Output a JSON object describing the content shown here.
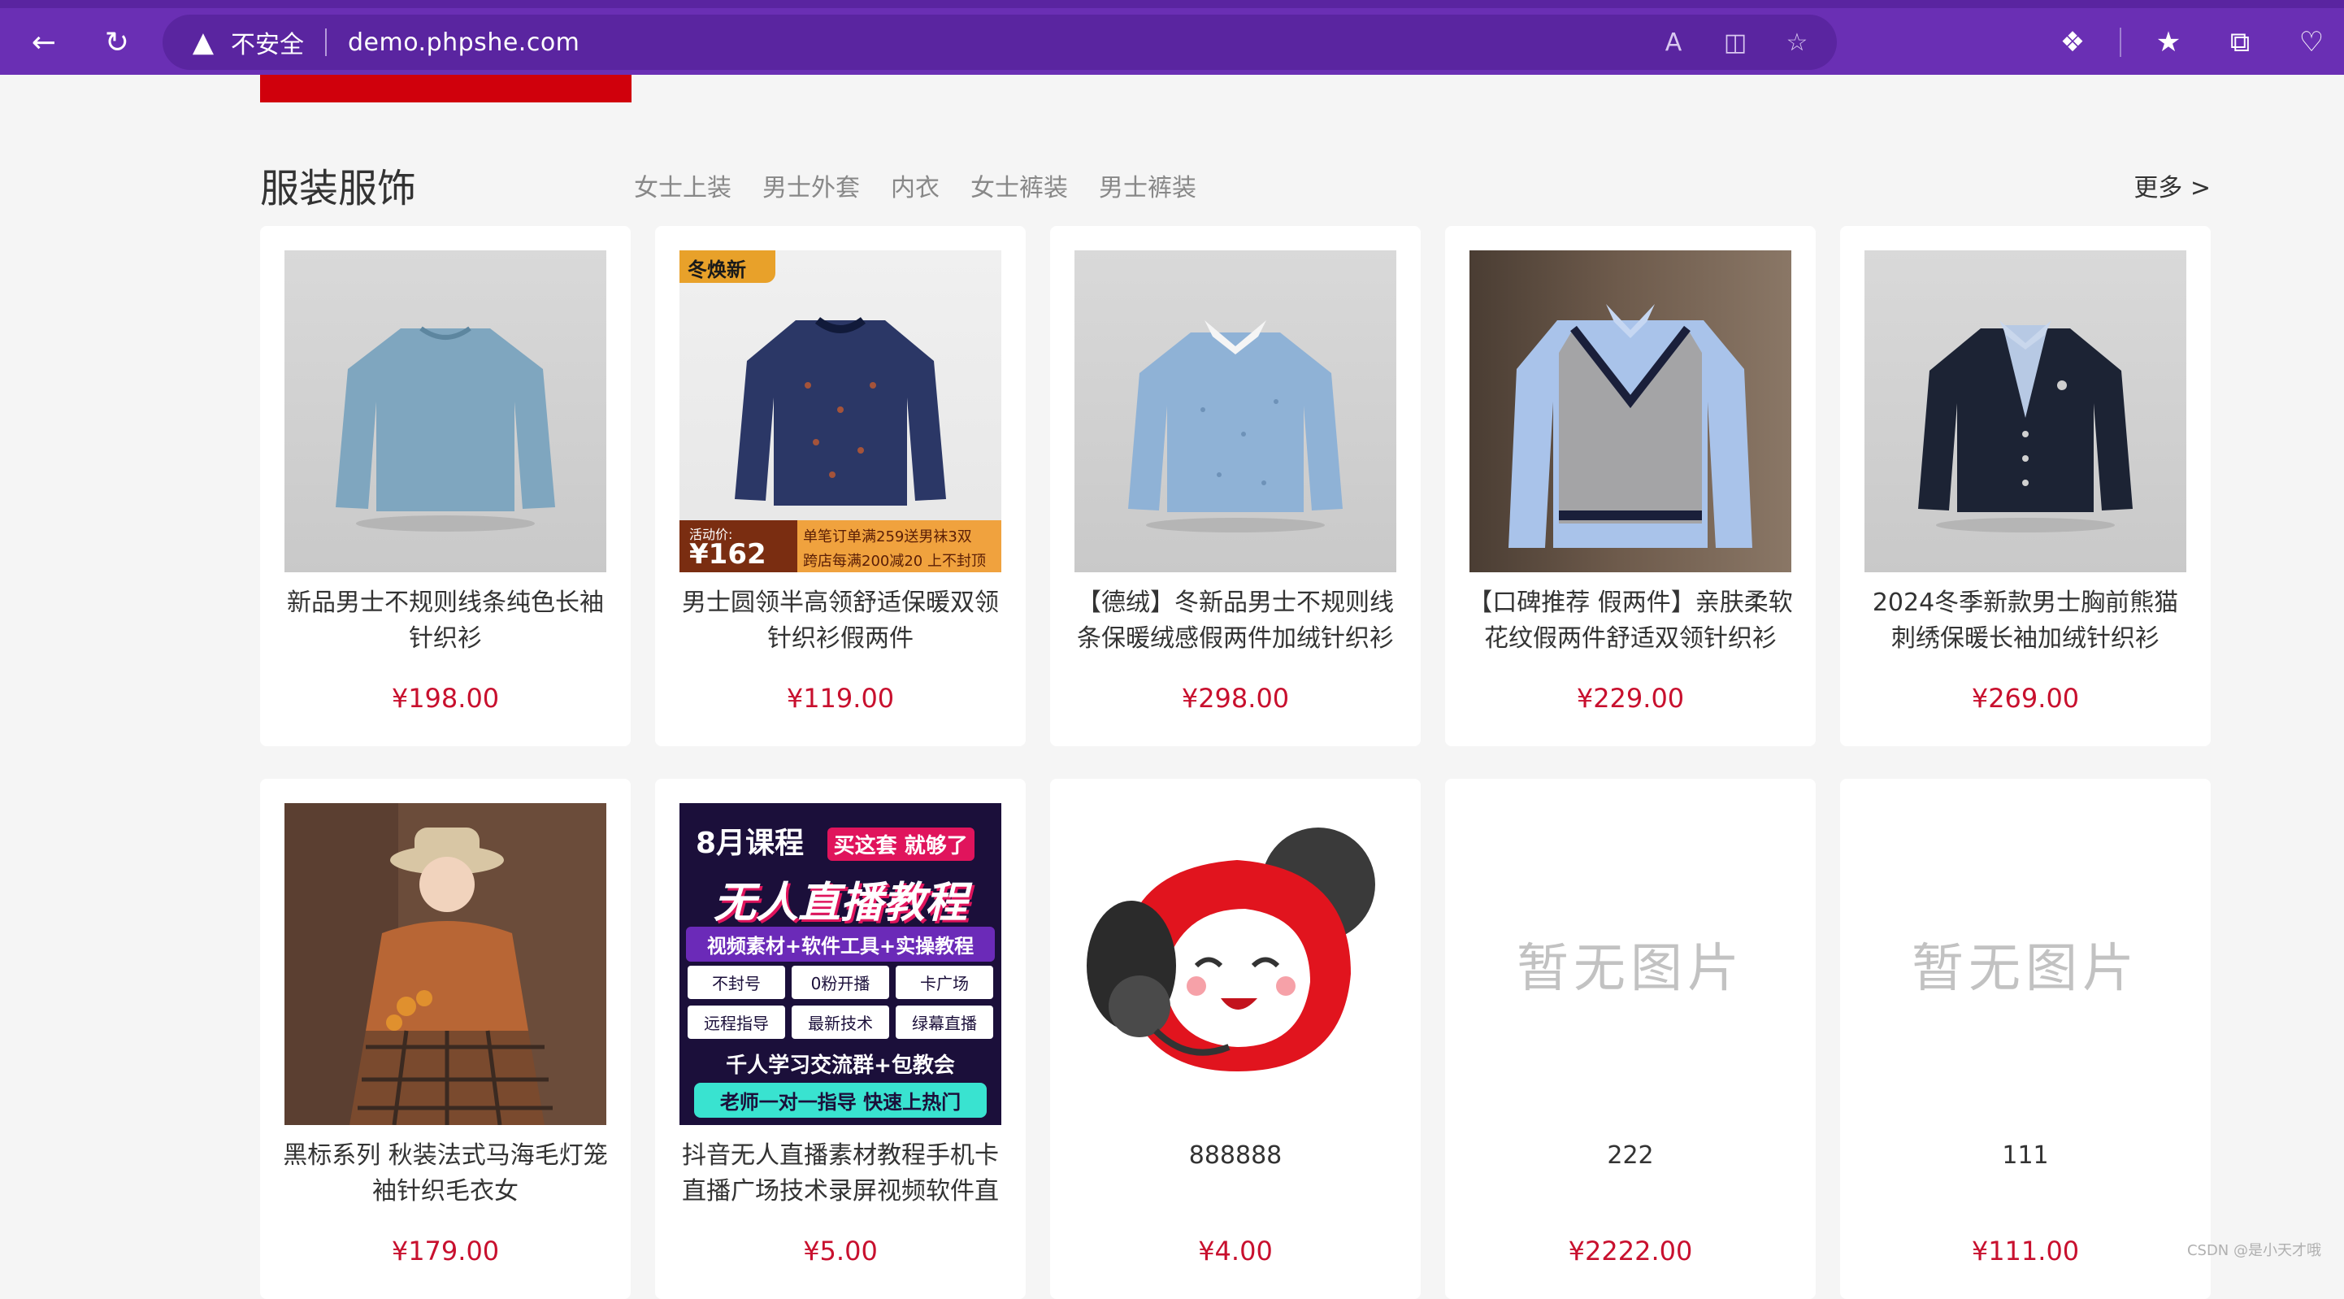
{
  "browser": {
    "insecure_label": "不安全",
    "url": "demo.phpshe.com"
  },
  "section": {
    "title": "服装服饰",
    "tabs": [
      "女士上装",
      "男士外套",
      "内衣",
      "女士裤装",
      "男士裤装"
    ],
    "more": "更多 >"
  },
  "products": [
    {
      "name": "新品男士不规则线条纯色长袖针织衫",
      "price": "¥198.00",
      "image": "sweater-light-blue"
    },
    {
      "name": "男士圆领半高领舒适保暖双领针织衫假两件",
      "price": "¥119.00",
      "image": "sweater-navy-promo"
    },
    {
      "name": "【德绒】冬新品男士不规则线条保暖绒感假两件加绒针织衫",
      "price": "¥298.00",
      "image": "sweater-blue-collar"
    },
    {
      "name": "【口碑推荐 假两件】亲肤柔软花纹假两件舒适双领针织衫",
      "price": "¥229.00",
      "image": "vest-grey"
    },
    {
      "name": "2024冬季新款男士胸前熊猫刺绣保暖长袖加绒针织衫",
      "price": "¥269.00",
      "image": "cardigan-navy"
    },
    {
      "name": "黑标系列 秋装法式马海毛灯笼袖针织毛衣女",
      "price": "¥179.00",
      "image": "woman-autumn"
    },
    {
      "name": "抖音无人直播素材教程手机卡直播广场技术录屏视频软件直播间",
      "price": "¥5.00",
      "image": "poster-live"
    },
    {
      "name": "888888",
      "price": "¥4.00",
      "image": "mascot"
    },
    {
      "name": "222",
      "price": "¥2222.00",
      "image": "none"
    },
    {
      "name": "111",
      "price": "¥111.00",
      "image": "none"
    }
  ],
  "promo": {
    "badge": "冬焕新",
    "activity_label": "活动价:",
    "activity_price": "162",
    "offer1": "单笔订单满259送男袜3双",
    "offer2": "跨店每满200减20 上不封顶"
  },
  "poster": {
    "line1": "8月课程",
    "line2": "买这套 就够了",
    "line3": "无人直播教程",
    "line4": "视频素材+软件工具+实操教程",
    "checks": [
      "不封号",
      "0粉开播",
      "卡广场",
      "远程指导",
      "最新技术",
      "绿幕直播"
    ],
    "line5": "千人学习交流群+包教会",
    "line6": "老师一对一指导 快速上热门"
  },
  "no_image_text": "暂无图片",
  "watermark": "CSDN @是小天才哦",
  "colors": {
    "browser": "#6a2fb4",
    "price": "#c8102e",
    "banner": "#d0000c"
  }
}
